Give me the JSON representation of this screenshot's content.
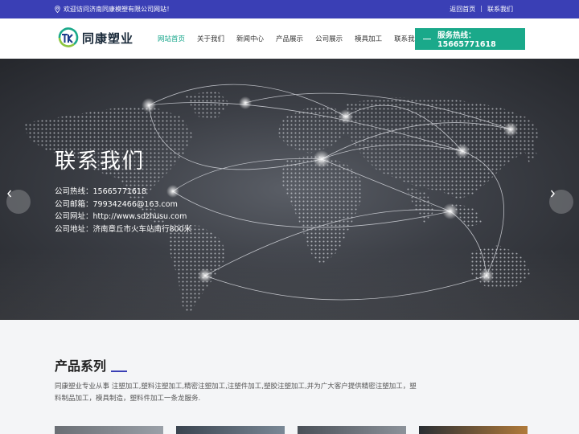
{
  "topbar": {
    "welcome": "欢迎访问济南同康模塑有限公司网站！",
    "links": [
      "返回首页",
      "|",
      "联系我们"
    ]
  },
  "header": {
    "logo_text": "同康塑业",
    "nav": [
      {
        "label": "网站首页",
        "active": true
      },
      {
        "label": "关于我们",
        "active": false
      },
      {
        "label": "新闻中心",
        "active": false
      },
      {
        "label": "产品展示",
        "active": false
      },
      {
        "label": "公司展示",
        "active": false
      },
      {
        "label": "模具加工",
        "active": false
      },
      {
        "label": "联系我们",
        "active": false
      }
    ],
    "hotline": "服务热线：15665771618"
  },
  "banner": {
    "title": "联系我们",
    "info": [
      "公司热线：15665771618",
      "公司邮箱：799342466@163.com",
      "公司网址：http://www.sdzhusu.com",
      "公司地址：济南章丘市火车站南行800米"
    ],
    "prev_icon": "chevron-left-icon",
    "next_icon": "chevron-right-icon"
  },
  "products": {
    "title": "产品系列",
    "description": "同康塑业专业从事 注塑加工,塑料注塑加工,精密注塑加工,注塑件加工,塑胶注塑加工,并为广大客户提供精密注塑加工，塑料制品加工，模具制造，塑料件加工一条龙服务."
  },
  "colors": {
    "topbar": "#3a3fb5",
    "accent": "#1aa98a",
    "nav_active": "#14a58a"
  }
}
